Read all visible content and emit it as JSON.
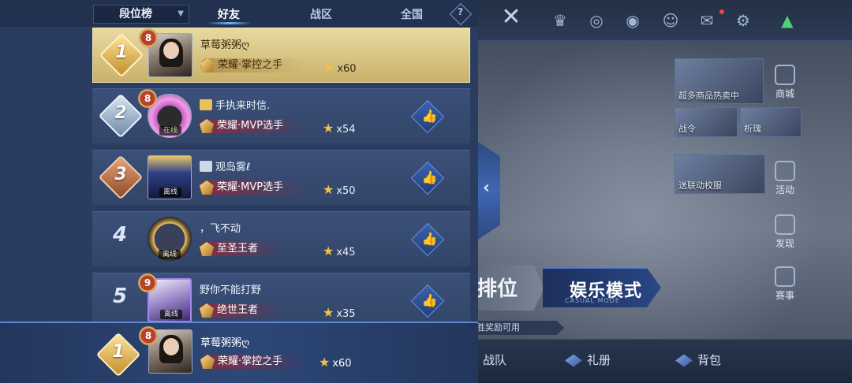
{
  "panel": {
    "dropdown_label": "段位榜",
    "tabs": [
      {
        "label": "好友",
        "active": true
      },
      {
        "label": "战区",
        "active": false
      },
      {
        "label": "全国",
        "active": false
      }
    ],
    "help_symbol": "?"
  },
  "rows": [
    {
      "rank": "1",
      "level": "8",
      "name": "草莓粥粥ღ",
      "tier": "荣耀·掌控之手",
      "stars": "x60",
      "status": ""
    },
    {
      "rank": "2",
      "level": "8",
      "name": "手执来时信.",
      "tier": "荣耀·MVP选手",
      "stars": "x54",
      "status": "在线"
    },
    {
      "rank": "3",
      "level": "",
      "name": "观岛雾ℓ",
      "tier": "荣耀·MVP选手",
      "stars": "x50",
      "status": "离线"
    },
    {
      "rank": "4",
      "level": "",
      "name": "，飞不动",
      "tier": "至圣王者",
      "stars": "x45",
      "status": "离线"
    },
    {
      "rank": "5",
      "level": "9",
      "name": "野你不能打野",
      "tier": "绝世王者",
      "stars": "x35",
      "status": "离线"
    }
  ],
  "self": {
    "rank": "1",
    "level": "8",
    "name": "草莓粥粥ღ",
    "tier": "荣耀·掌控之手",
    "stars": "x60"
  },
  "background": {
    "close_symbol": "✕",
    "promo_captions": [
      "超多商品热卖中",
      "战令",
      "析瑰",
      "送联动校服"
    ],
    "side_buttons": [
      "商城",
      "活动",
      "发现",
      "赛事"
    ],
    "mode_rank": "排位",
    "mode_entertainment": "娱乐模式",
    "mode_entertainment_en": "CASUAL MODE",
    "note": "胜奖励可用",
    "bottom_items": [
      "战队",
      "礼册",
      "背包"
    ]
  }
}
